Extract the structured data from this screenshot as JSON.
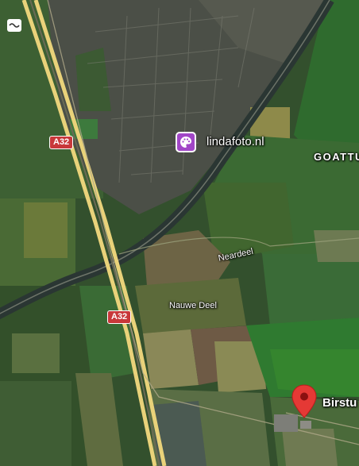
{
  "map": {
    "road_shields": [
      {
        "id": "a32-top",
        "text": "A32"
      },
      {
        "id": "a32-bottom",
        "text": "A32"
      }
    ],
    "poi": {
      "label": "lindafoto.nl",
      "icon": "palette-icon",
      "color": "#a146c7"
    },
    "place_labels": {
      "goattum": "GOATTU",
      "neardeel": "Neardeel",
      "nauwe_deel": "Nauwe Deel",
      "birstum": "Birstu"
    },
    "marker": {
      "icon": "map-pin-icon",
      "color": "#e53935"
    },
    "corner_icon": "layers-icon"
  }
}
